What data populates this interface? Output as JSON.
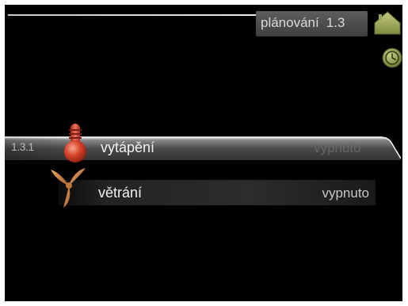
{
  "header": {
    "menu_title": "plánování",
    "menu_number": "1.3"
  },
  "menu": {
    "items": [
      {
        "index": "1.3.1",
        "label": "vytápění",
        "status": "vypnuto",
        "selected": true,
        "icon": "thermometer-icon"
      },
      {
        "index": "",
        "label": "větrání",
        "status": "vypnuto",
        "selected": false,
        "icon": "fan-icon"
      }
    ]
  },
  "icons": {
    "home": "home-icon",
    "clock": "clock-icon"
  },
  "colors": {
    "background": "#000000",
    "icon_green": "#9aa45a",
    "thermometer_red": "#d6442a",
    "fan_orange": "#cf8a4e"
  }
}
